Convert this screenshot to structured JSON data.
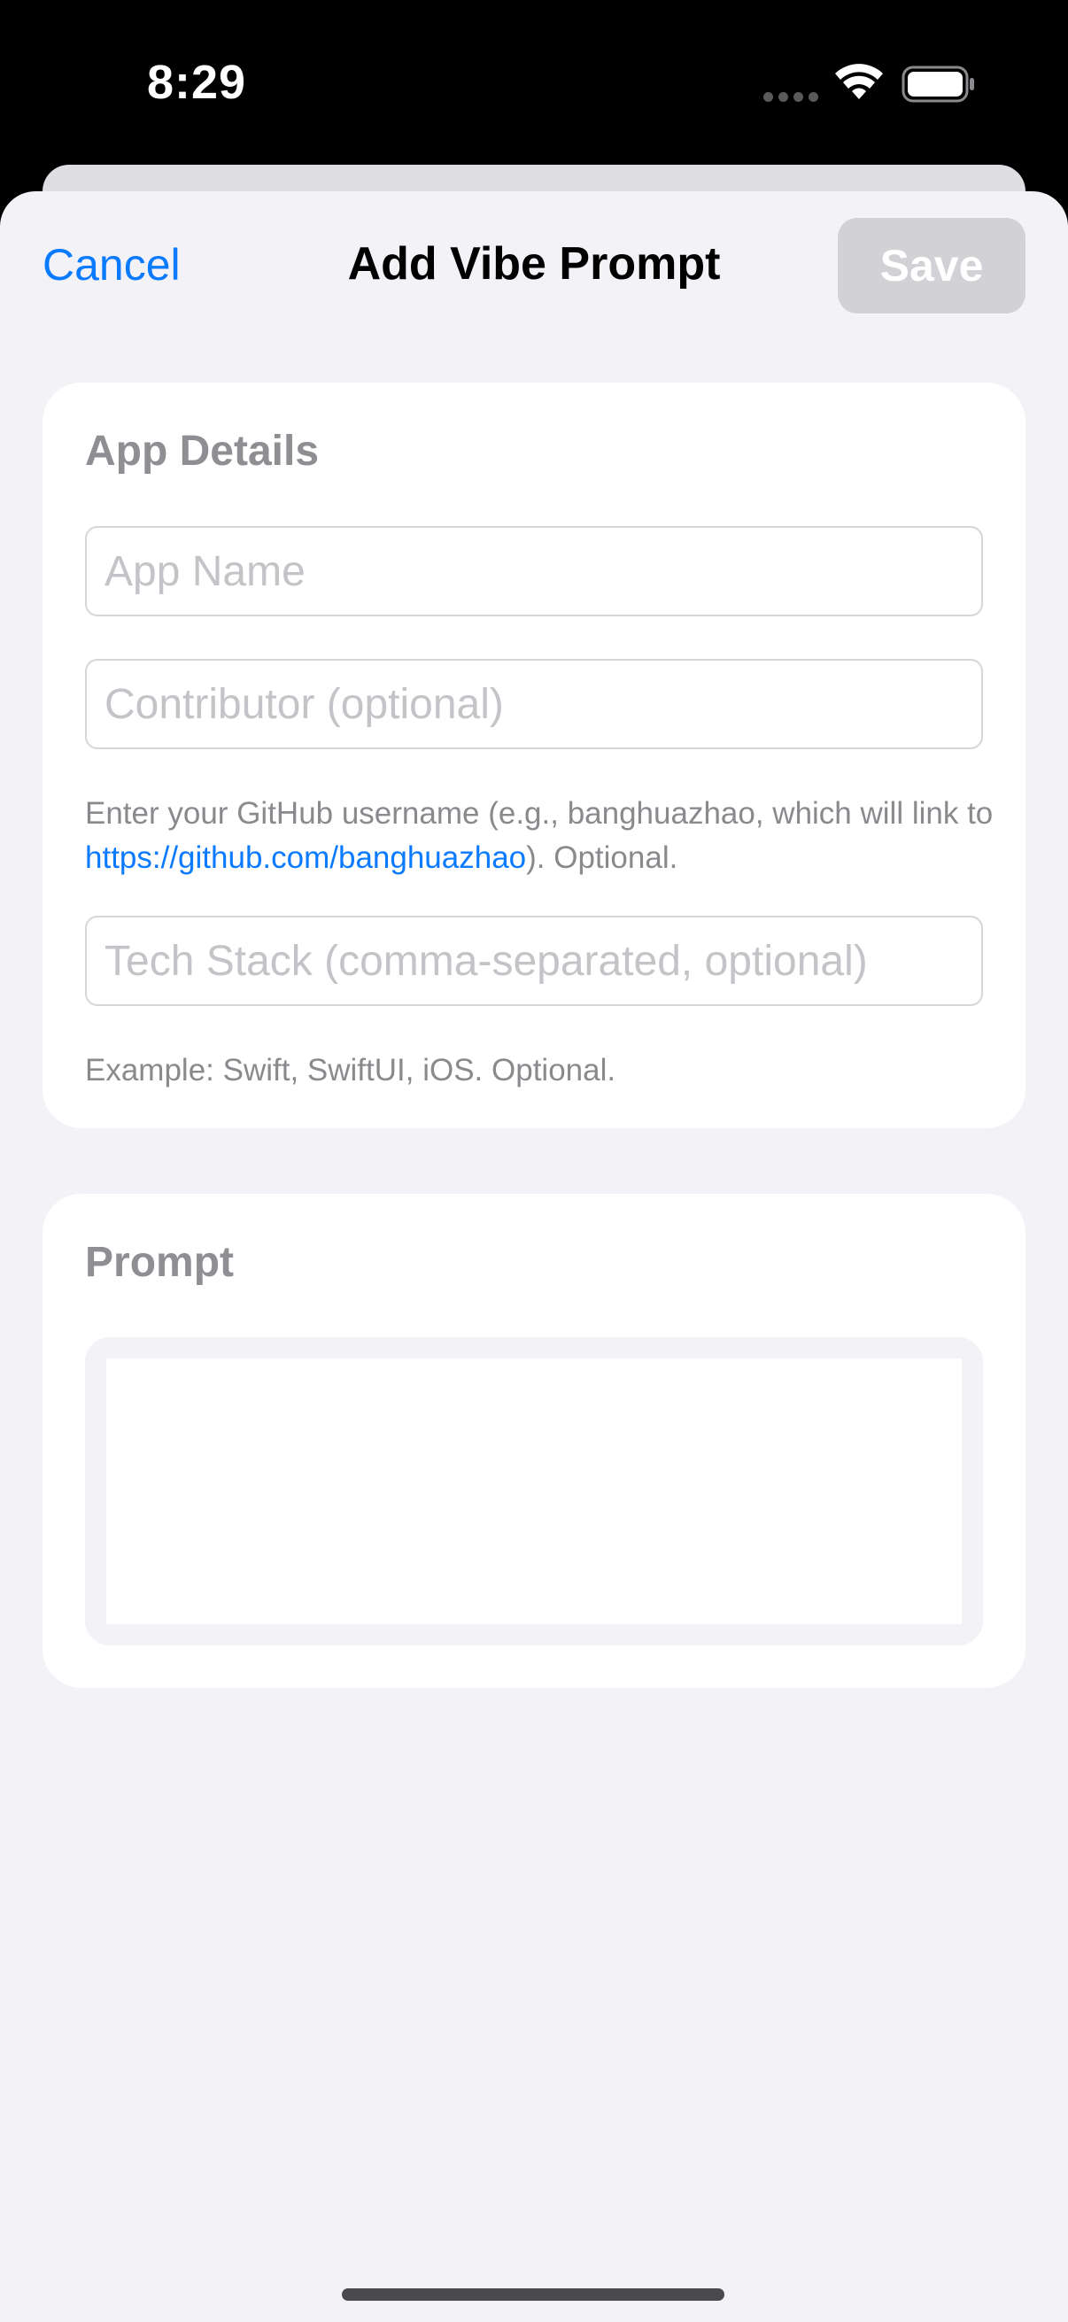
{
  "status_bar": {
    "time": "8:29",
    "signal_icon": "cellular-dots-icon",
    "wifi_icon": "wifi-icon",
    "battery_icon": "battery-icon"
  },
  "nav": {
    "cancel_label": "Cancel",
    "title": "Add Vibe Prompt",
    "save_label": "Save"
  },
  "app_details": {
    "section_title": "App Details",
    "app_name": {
      "value": "",
      "placeholder": "App Name"
    },
    "contributor": {
      "value": "",
      "placeholder": "Contributor (optional)"
    },
    "contributor_help_prefix": "Enter your GitHub username (e.g., banghuazhao, which will link to ",
    "contributor_help_link": "https://github.com/banghuazhao",
    "contributor_help_suffix": "). Optional.",
    "tech_stack": {
      "value": "",
      "placeholder": "Tech Stack (comma-separated, optional)"
    },
    "tech_stack_help": "Example: Swift, SwiftUI, iOS. Optional."
  },
  "prompt": {
    "section_title": "Prompt",
    "value": ""
  },
  "colors": {
    "accent": "#0a7aff",
    "background": "#f2f2f7",
    "save_disabled": "#d1d1d6"
  }
}
